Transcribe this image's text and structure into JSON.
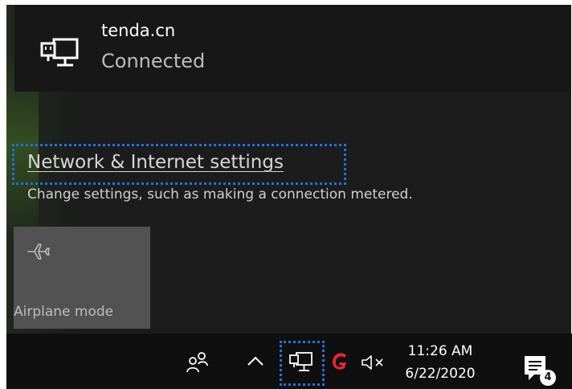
{
  "network": {
    "name": "tenda.cn",
    "status": "Connected",
    "icon": "ethernet-monitor-icon"
  },
  "settings": {
    "link_label": "Network & Internet settings",
    "description": "Change settings, such as making a connection metered."
  },
  "quick_actions": [
    {
      "label": "Airplane mode",
      "icon": "airplane-icon",
      "state": "off"
    }
  ],
  "taskbar": {
    "time": "11:26 AM",
    "date": "6/22/2020",
    "notification_count": "4",
    "tray_icons": [
      "people-icon",
      "chevron-up-icon",
      "ethernet-monitor-icon",
      "g-app-icon",
      "speaker-muted-icon",
      "action-center-icon"
    ]
  },
  "colors": {
    "focus_outline": "#1c73e8",
    "flyout_bg": "#1c1c1c",
    "taskbar_bg": "#0f0f0f",
    "tile_bg": "#525252",
    "g_icon_red": "#e3262b"
  }
}
